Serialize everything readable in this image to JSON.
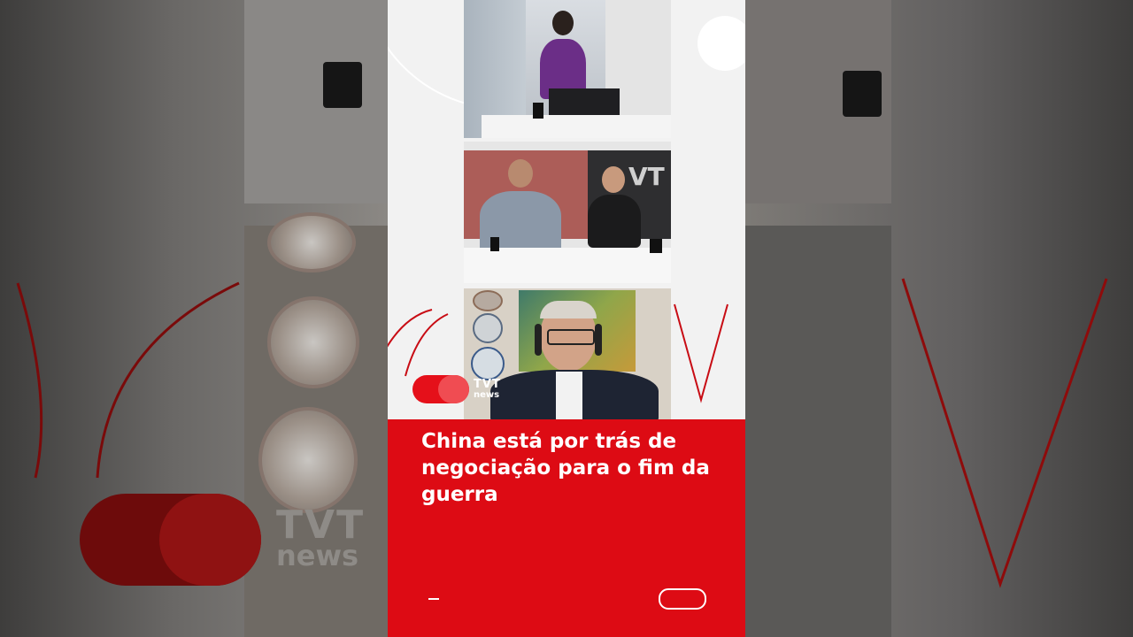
{
  "headline": "China está por trás de negociação para o fim da guerra",
  "logo": {
    "line1": "TVT",
    "line2": "news"
  },
  "background_logo": {
    "line1": "TVT",
    "line2": "news"
  },
  "colors": {
    "brand_red": "#dd0b14",
    "logo_red": "#e5101a",
    "text": "#ffffff",
    "panel_bg": "#f2f2f2"
  },
  "icons": [
    "tvt-news-logo",
    "progress-line",
    "toggle-pill"
  ]
}
